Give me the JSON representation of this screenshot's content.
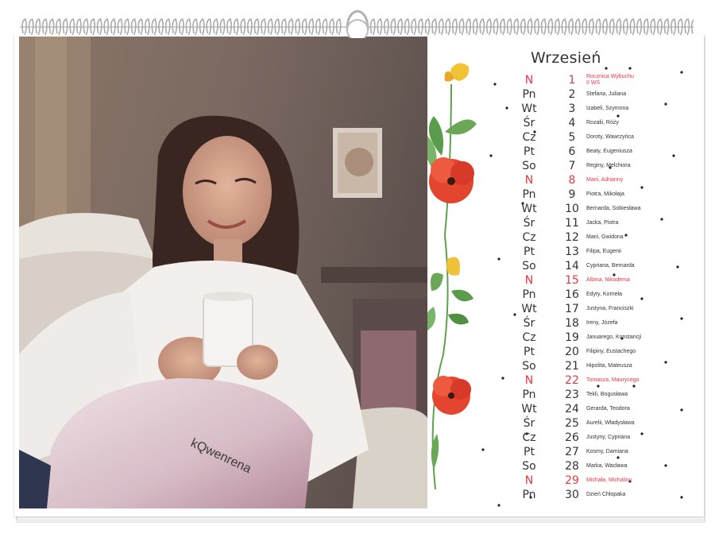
{
  "calendar": {
    "month": "Wrzesień",
    "days": [
      {
        "dow": "N",
        "day": "1",
        "names": "Rocznica Wybuchu II WŚ",
        "sunday": true
      },
      {
        "dow": "Pn",
        "day": "2",
        "names": "Stefana, Juliana",
        "sunday": false
      },
      {
        "dow": "Wt",
        "day": "3",
        "names": "Izabeli, Szymona",
        "sunday": false
      },
      {
        "dow": "Śr",
        "day": "4",
        "names": "Rozalii, Róży",
        "sunday": false
      },
      {
        "dow": "Cz",
        "day": "5",
        "names": "Doroty, Wawrzyńca",
        "sunday": false
      },
      {
        "dow": "Pt",
        "day": "6",
        "names": "Beaty, Eugeniusza",
        "sunday": false
      },
      {
        "dow": "So",
        "day": "7",
        "names": "Reginy, Melchiora",
        "sunday": false
      },
      {
        "dow": "N",
        "day": "8",
        "names": "Marii, Adrianny",
        "sunday": true
      },
      {
        "dow": "Pn",
        "day": "9",
        "names": "Piotra, Mikołaja",
        "sunday": false
      },
      {
        "dow": "Wt",
        "day": "10",
        "names": "Bernarda, Sobiesława",
        "sunday": false
      },
      {
        "dow": "Śr",
        "day": "11",
        "names": "Jacka, Piotra",
        "sunday": false
      },
      {
        "dow": "Cz",
        "day": "12",
        "names": "Marii, Gwidona",
        "sunday": false
      },
      {
        "dow": "Pt",
        "day": "13",
        "names": "Filipa, Eugenii",
        "sunday": false
      },
      {
        "dow": "So",
        "day": "14",
        "names": "Cypriana, Bernarda",
        "sunday": false
      },
      {
        "dow": "N",
        "day": "15",
        "names": "Albina, Nikodema",
        "sunday": true
      },
      {
        "dow": "Pn",
        "day": "16",
        "names": "Edyty, Korneła",
        "sunday": false
      },
      {
        "dow": "Wt",
        "day": "17",
        "names": "Justyna, Franciszki",
        "sunday": false
      },
      {
        "dow": "Śr",
        "day": "18",
        "names": "Ireny, Józefa",
        "sunday": false
      },
      {
        "dow": "Cz",
        "day": "19",
        "names": "Januarego, Konstancji",
        "sunday": false
      },
      {
        "dow": "Pt",
        "day": "20",
        "names": "Filipiny, Eustachego",
        "sunday": false
      },
      {
        "dow": "So",
        "day": "21",
        "names": "Hipolita, Mateusza",
        "sunday": false
      },
      {
        "dow": "N",
        "day": "22",
        "names": "Tomasza, Maurycego",
        "sunday": true
      },
      {
        "dow": "Pn",
        "day": "23",
        "names": "Tekli, Bogusława",
        "sunday": false
      },
      {
        "dow": "Wt",
        "day": "24",
        "names": "Gerarda, Teodora",
        "sunday": false
      },
      {
        "dow": "Śr",
        "day": "25",
        "names": "Aurelii, Władysława",
        "sunday": false
      },
      {
        "dow": "Cz",
        "day": "26",
        "names": "Justyny, Cypriana",
        "sunday": false
      },
      {
        "dow": "Pt",
        "day": "27",
        "names": "Kosmy, Damiana",
        "sunday": false
      },
      {
        "dow": "So",
        "day": "28",
        "names": "Marka, Wacława",
        "sunday": false
      },
      {
        "dow": "N",
        "day": "29",
        "names": "Michała, Michaliny",
        "sunday": true
      },
      {
        "dow": "Pn",
        "day": "30",
        "names": "Dzień Chłopaka",
        "sunday": false
      }
    ]
  },
  "colors": {
    "sunday": "#e53945",
    "text": "#333333",
    "wire": "#b9b9b9"
  },
  "photo": {
    "subject": "woman-with-mug-on-sofa"
  }
}
